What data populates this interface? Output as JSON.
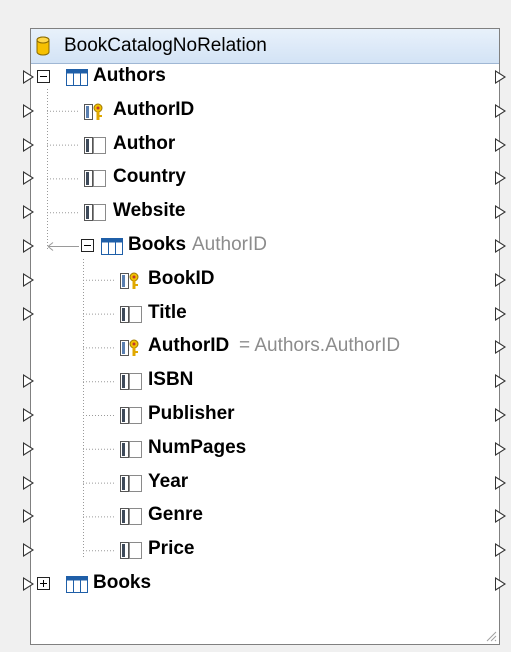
{
  "component": {
    "title": "BookCatalogNoRelation",
    "icon": "database-icon"
  },
  "rows": [
    {
      "id": "authors-table",
      "label": "Authors",
      "icon": "table-icon",
      "expander": "minus",
      "in_port": true,
      "out_port": true
    },
    {
      "id": "authorid",
      "label": "AuthorID",
      "icon": "key-icon",
      "in_port": true,
      "out_port": true
    },
    {
      "id": "author",
      "label": "Author",
      "icon": "column-icon",
      "in_port": true,
      "out_port": true
    },
    {
      "id": "country",
      "label": "Country",
      "icon": "column-icon",
      "in_port": true,
      "out_port": true
    },
    {
      "id": "website",
      "label": "Website",
      "icon": "column-icon",
      "in_port": true,
      "out_port": true
    },
    {
      "id": "books-nested",
      "label": "Books",
      "annotation": "AuthorID",
      "icon": "table-icon",
      "expander": "minus",
      "in_port": true,
      "out_port": true
    },
    {
      "id": "bookid",
      "label": "BookID",
      "icon": "key-icon",
      "in_port": true,
      "out_port": true
    },
    {
      "id": "title",
      "label": "Title",
      "icon": "column-icon",
      "in_port": true,
      "out_port": true
    },
    {
      "id": "books-authorid",
      "label": "AuthorID",
      "annotation": "= Authors.AuthorID",
      "icon": "key-icon",
      "in_port": false,
      "out_port": true
    },
    {
      "id": "isbn",
      "label": "ISBN",
      "icon": "column-icon",
      "in_port": true,
      "out_port": true
    },
    {
      "id": "publisher",
      "label": "Publisher",
      "icon": "column-icon",
      "in_port": true,
      "out_port": true
    },
    {
      "id": "numpages",
      "label": "NumPages",
      "icon": "column-icon",
      "in_port": true,
      "out_port": true
    },
    {
      "id": "year",
      "label": "Year",
      "icon": "column-icon",
      "in_port": true,
      "out_port": true
    },
    {
      "id": "genre",
      "label": "Genre",
      "icon": "column-icon",
      "in_port": true,
      "out_port": true
    },
    {
      "id": "price",
      "label": "Price",
      "icon": "column-icon",
      "in_port": true,
      "out_port": true
    },
    {
      "id": "books-table",
      "label": "Books",
      "icon": "table-icon",
      "expander": "plus",
      "in_port": true,
      "out_port": true
    }
  ]
}
